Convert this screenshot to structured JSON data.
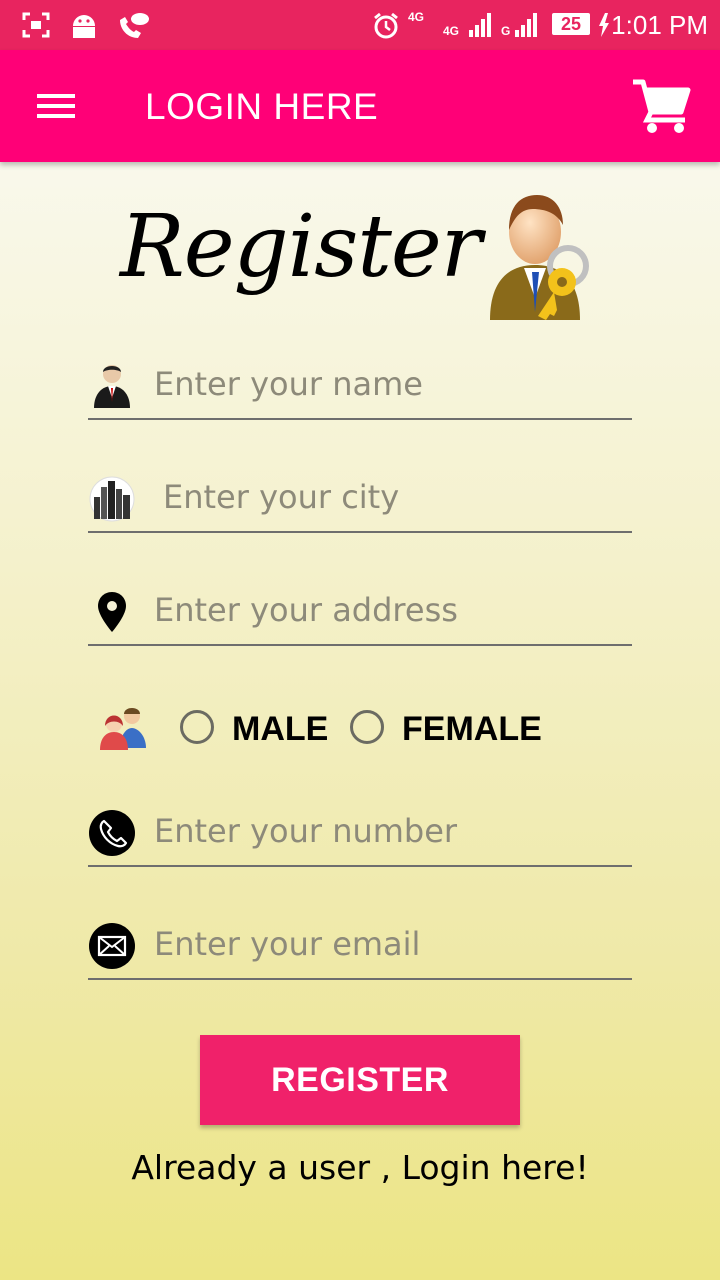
{
  "status_bar": {
    "time": "1:01 PM",
    "battery": "25",
    "network_1": "4G",
    "network_2": "4G",
    "network_3": "G"
  },
  "app_bar": {
    "title": "LOGIN HERE",
    "accent_color": "#ff0077"
  },
  "register": {
    "heading": "Register"
  },
  "form": {
    "name_placeholder": "Enter your name",
    "city_placeholder": "Enter your city",
    "address_placeholder": "Enter your address",
    "number_placeholder": "Enter your number",
    "email_placeholder": "Enter your email",
    "gender": {
      "male_label": "MALE",
      "female_label": "FEMALE",
      "selected": ""
    }
  },
  "register_button_label": "REGISTER",
  "login_link_text": "Already a user , Login here!",
  "colors": {
    "status_bar": "#e8245f",
    "button": "#f0216a"
  }
}
